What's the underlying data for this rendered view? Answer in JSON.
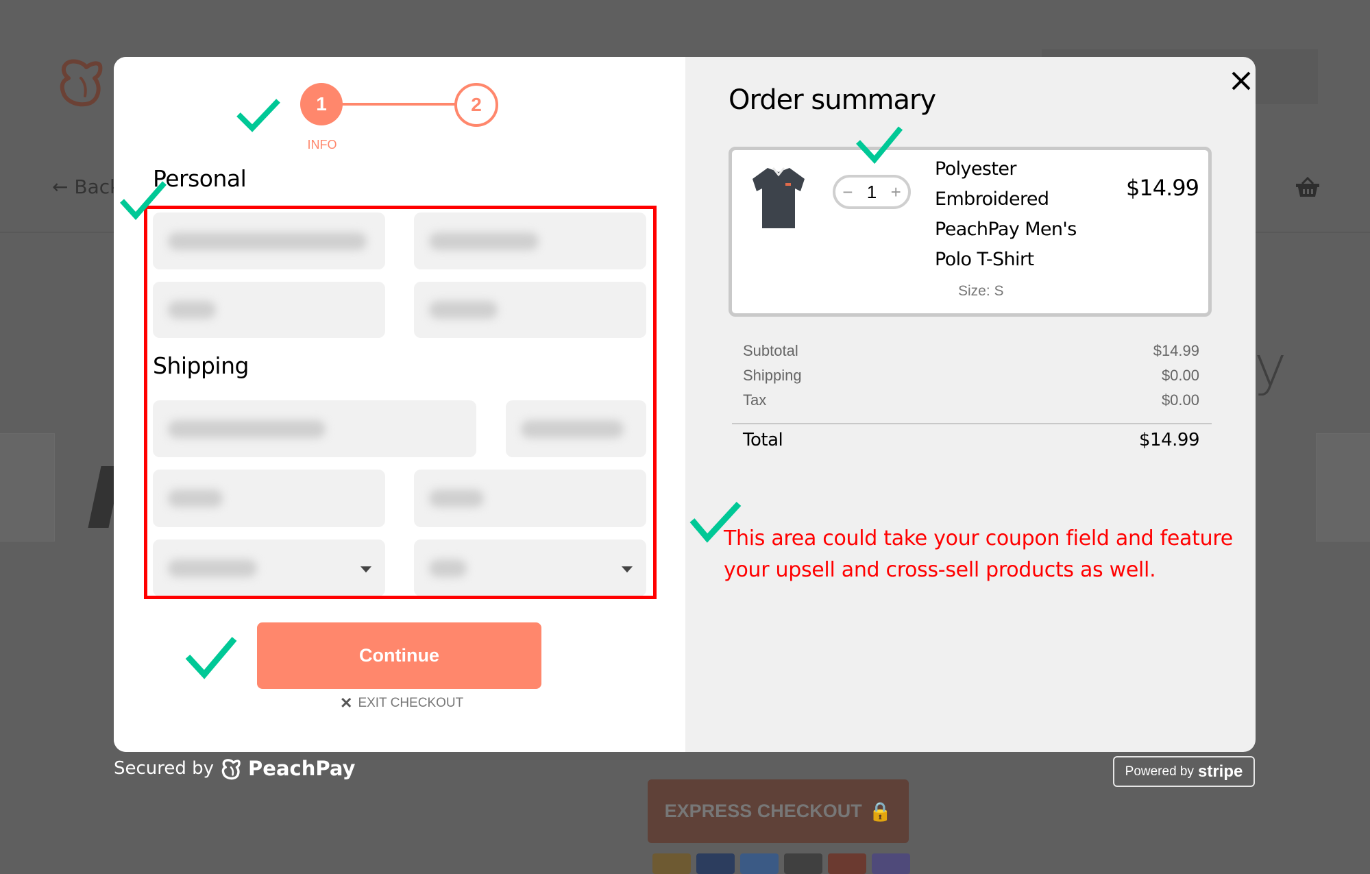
{
  "background_page": {
    "back_label": "Back",
    "title_fragment": "y",
    "express_checkout_label": "EXPRESS CHECKOUT",
    "payment_logos": [
      "PayPal",
      "VISA",
      "American Express",
      "Discover",
      "Mastercard",
      "Stripe"
    ]
  },
  "stepper": {
    "steps": [
      {
        "number": "1",
        "label": "INFO",
        "active": true
      },
      {
        "number": "2",
        "label": "",
        "active": false
      }
    ]
  },
  "form": {
    "personal_title": "Personal",
    "shipping_title": "Shipping",
    "continue_label": "Continue",
    "exit_label": "EXIT CHECKOUT"
  },
  "order_summary": {
    "title": "Order summary",
    "item": {
      "name": "Polyester Embroidered PeachPay Men's Polo T-Shirt",
      "name_lines": [
        "Polyester",
        "Embroidered",
        "PeachPay Men's",
        "Polo T-Shirt"
      ],
      "quantity": "1",
      "price": "$14.99",
      "variant": "Size: S"
    },
    "rows": [
      {
        "label": "Subtotal",
        "value": "$14.99"
      },
      {
        "label": "Shipping",
        "value": "$0.00"
      },
      {
        "label": "Tax",
        "value": "$0.00"
      }
    ],
    "total_label": "Total",
    "total_value": "$14.99"
  },
  "annotation": {
    "note": "This area could take your coupon field and feature your upsell and cross-sell products as well.",
    "check_color": "#00c896",
    "highlight_color": "#ff0000"
  },
  "footer": {
    "secured_by": "Secured by",
    "brand": "PeachPay",
    "powered_by": "Powered by",
    "stripe": "stripe"
  },
  "colors": {
    "accent": "#ff876c",
    "overlay": "#5f5f5f",
    "summary_bg": "#f0f0f0"
  }
}
